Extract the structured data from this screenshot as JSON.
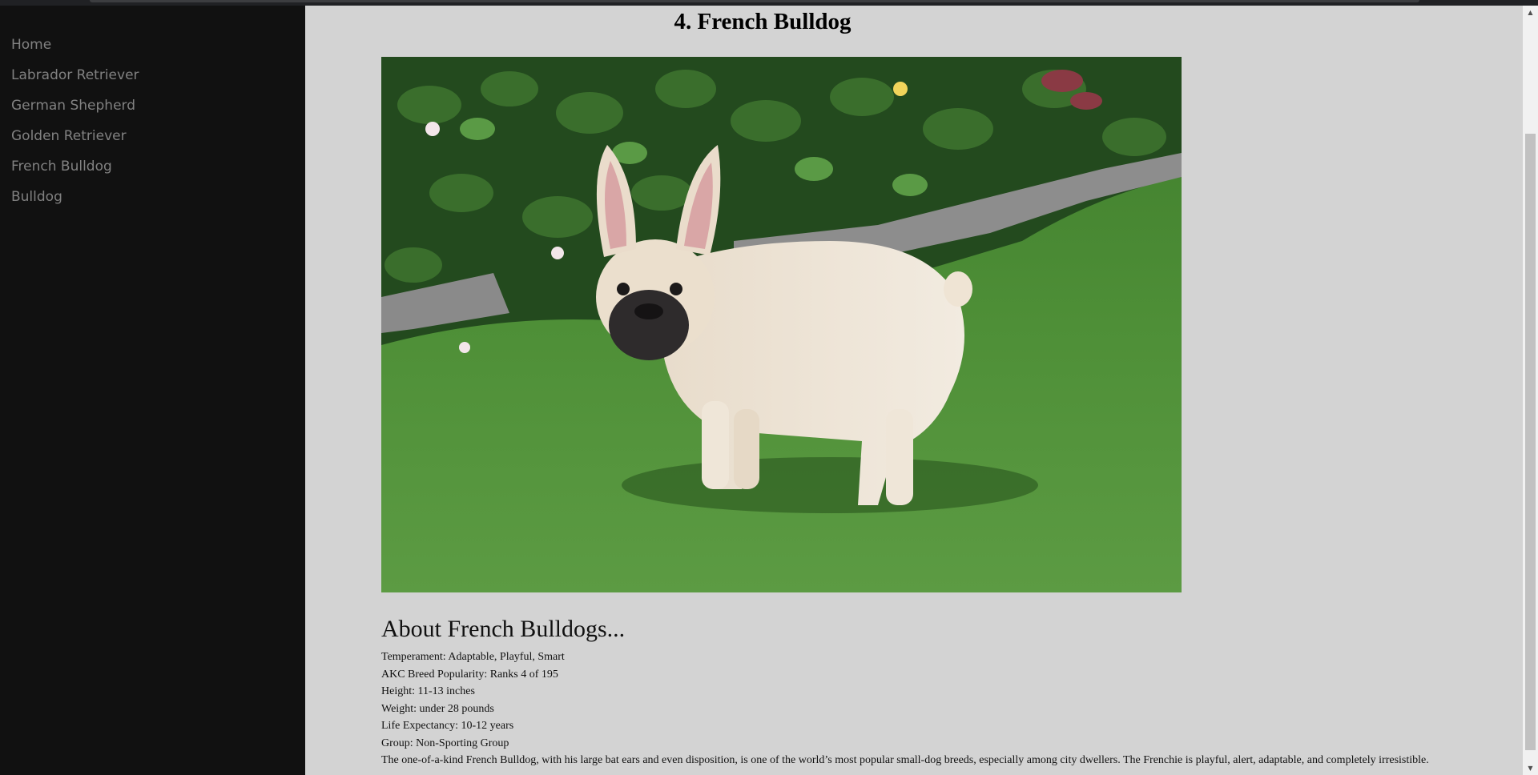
{
  "sidebar": {
    "items": [
      {
        "label": "Home"
      },
      {
        "label": "Labrador Retriever"
      },
      {
        "label": "German Shepherd"
      },
      {
        "label": "Golden Retriever"
      },
      {
        "label": "French Bulldog"
      },
      {
        "label": "Bulldog"
      }
    ]
  },
  "main": {
    "title": "4. French Bulldog",
    "about_heading": "About French Bulldogs...",
    "facts": [
      "Temperament: Adaptable, Playful, Smart",
      "AKC Breed Popularity: Ranks 4 of 195",
      "Height: 11-13 inches",
      "Weight: under 28 pounds",
      "Life Expectancy: 10-12 years",
      "Group: Non-Sporting Group",
      "The one-of-a-kind French Bulldog, with his large bat ears and even disposition, is one of the world’s most popular small-dog breeds, especially among city dwellers. The Frenchie is playful, alert, adaptable, and completely irresistible."
    ]
  },
  "colors": {
    "sidebar_bg": "#111111",
    "nav_text": "#818181",
    "page_bg": "#d3d3d3"
  }
}
